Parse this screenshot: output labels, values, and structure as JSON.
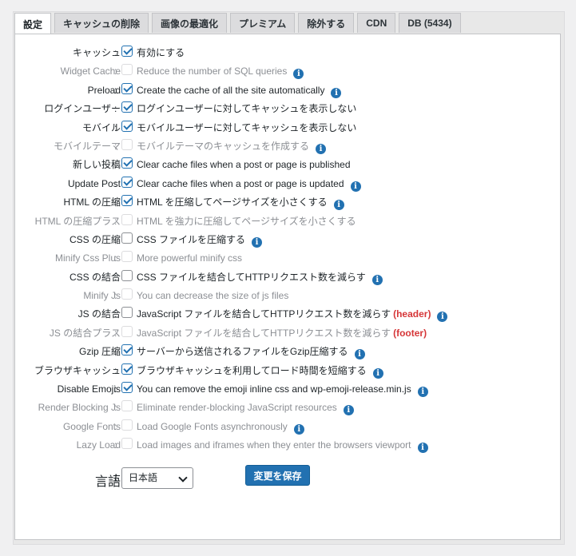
{
  "tabs": [
    {
      "label": "設定",
      "active": true
    },
    {
      "label": "キャッシュの削除"
    },
    {
      "label": "画像の最適化"
    },
    {
      "label": "プレミアム"
    },
    {
      "label": "除外する"
    },
    {
      "label": "CDN"
    },
    {
      "label": "DB (5434)"
    }
  ],
  "colon": ":",
  "info_glyph": "i",
  "settings": [
    {
      "label": "キャッシュ",
      "desc": "有効にする",
      "checked": true,
      "disabled": false,
      "info": false
    },
    {
      "label": "Widget Cache",
      "desc": "Reduce the number of SQL queries",
      "checked": false,
      "disabled": true,
      "info": true
    },
    {
      "label": "Preload",
      "desc": "Create the cache of all the site automatically",
      "checked": true,
      "disabled": false,
      "info": true
    },
    {
      "label": "ログインユーザー",
      "desc": "ログインユーザーに対してキャッシュを表示しない",
      "checked": true,
      "disabled": false,
      "info": false
    },
    {
      "label": "モバイル",
      "desc": "モバイルユーザーに対してキャッシュを表示しない",
      "checked": true,
      "disabled": false,
      "info": false
    },
    {
      "label": "モバイルテーマ",
      "desc": "モバイルテーマのキャッシュを作成する",
      "checked": false,
      "disabled": true,
      "info": true
    },
    {
      "label": "新しい投稿",
      "desc": "Clear cache files when a post or page is published",
      "checked": true,
      "disabled": false,
      "info": false
    },
    {
      "label": "Update Post",
      "desc": "Clear cache files when a post or page is updated",
      "checked": true,
      "disabled": false,
      "info": true
    },
    {
      "label": "HTML の圧縮",
      "desc": "HTML を圧縮してページサイズを小さくする",
      "checked": true,
      "disabled": false,
      "info": true
    },
    {
      "label": "HTML の圧縮プラス",
      "desc": "HTML を強力に圧縮してページサイズを小さくする",
      "checked": false,
      "disabled": true,
      "info": false
    },
    {
      "label": "CSS の圧縮",
      "desc": "CSS ファイルを圧縮する",
      "checked": false,
      "disabled": false,
      "info": true
    },
    {
      "label": "Minify Css Plus",
      "desc": "More powerful minify css",
      "checked": false,
      "disabled": true,
      "info": false
    },
    {
      "label": "CSS の結合",
      "desc": "CSS ファイルを結合してHTTPリクエスト数を減らす",
      "checked": false,
      "disabled": false,
      "info": true
    },
    {
      "label": "Minify Js",
      "desc": "You can decrease the size of js files",
      "checked": false,
      "disabled": true,
      "info": false
    },
    {
      "label": "JS の結合",
      "desc": "JavaScript ファイルを結合してHTTPリクエスト数を減らす",
      "highlight": "(header)",
      "checked": false,
      "disabled": false,
      "info": true
    },
    {
      "label": "JS の結合プラス",
      "desc": "JavaScript ファイルを結合してHTTPリクエスト数を減らす",
      "highlight": "(footer)",
      "checked": false,
      "disabled": true,
      "info": false
    },
    {
      "label": "Gzip 圧縮",
      "desc": "サーバーから送信されるファイルをGzip圧縮する",
      "checked": true,
      "disabled": false,
      "info": true
    },
    {
      "label": "ブラウザキャッシュ",
      "desc": "ブラウザキャッシュを利用してロード時間を短縮する",
      "checked": true,
      "disabled": false,
      "info": true
    },
    {
      "label": "Disable Emojis",
      "desc": "You can remove the emoji inline css and wp-emoji-release.min.js",
      "checked": true,
      "disabled": false,
      "info": true
    },
    {
      "label": "Render Blocking Js",
      "desc": "Eliminate render-blocking JavaScript resources",
      "checked": false,
      "disabled": true,
      "info": true
    },
    {
      "label": "Google Fonts",
      "desc": "Load Google Fonts asynchronously",
      "checked": false,
      "disabled": true,
      "info": true
    },
    {
      "label": "Lazy Load",
      "desc": "Load images and iframes when they enter the browsers viewport",
      "checked": false,
      "disabled": true,
      "info": true
    }
  ],
  "language": {
    "label": "言語",
    "selected": "日本語"
  },
  "save_label": "変更を保存",
  "colors": {
    "accent": "#2271b1",
    "highlight": "#d63638"
  }
}
